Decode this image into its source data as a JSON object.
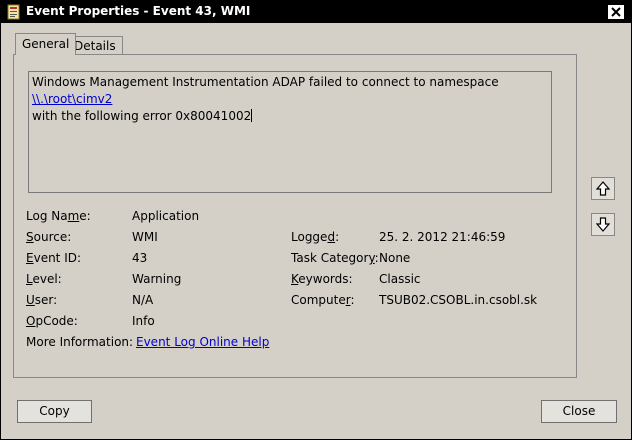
{
  "window": {
    "title": "Event Properties - Event 43, WMI"
  },
  "tabs": [
    {
      "label": "General"
    },
    {
      "label": "Details"
    }
  ],
  "description": {
    "line1_prefix": "Windows Management Instrumentation ADAP failed to connect to namespace ",
    "namespace_link": "\\\\.\\root\\cimv2",
    "line2": "with the following error 0x80041002"
  },
  "fields": {
    "log_name": {
      "label": "Log Name:",
      "value": "Application"
    },
    "source": {
      "label": "Source:",
      "value": "WMI"
    },
    "event_id": {
      "label": "Event ID:",
      "value": "43"
    },
    "level": {
      "label": "Level:",
      "value": "Warning"
    },
    "user": {
      "label": "User:",
      "value": "N/A"
    },
    "opcode": {
      "label": "OpCode:",
      "value": "Info"
    },
    "more_info": {
      "label": "More Information:",
      "value": "Event Log Online Help"
    },
    "logged": {
      "label": "Logged:",
      "value": "25. 2. 2012 21:46:59"
    },
    "task_category": {
      "label": "Task Category:",
      "value": "None"
    },
    "keywords": {
      "label": "Keywords:",
      "value": "Classic"
    },
    "computer": {
      "label": "Computer:",
      "value": "TSUB02.CSOBL.in.csobl.sk"
    }
  },
  "buttons": {
    "copy": "Copy",
    "close": "Close"
  },
  "icons": {
    "app": "event-viewer-icon",
    "close": "close-x-icon",
    "up": "arrow-up-icon",
    "down": "arrow-down-icon"
  },
  "colors": {
    "title_bar": "#000000",
    "background": "#d4d0c8",
    "link": "#0000cc"
  }
}
